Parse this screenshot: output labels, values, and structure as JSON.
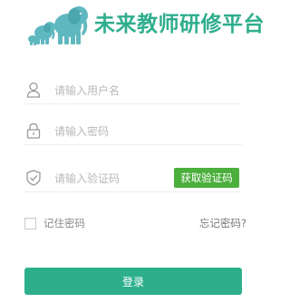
{
  "header": {
    "logo_icon": "elephant-family-icon",
    "title": "未来教师研修平台"
  },
  "form": {
    "username": {
      "icon": "user-icon",
      "placeholder": "请输入用户名",
      "value": ""
    },
    "password": {
      "icon": "lock-icon",
      "placeholder": "请输入密码",
      "value": ""
    },
    "captcha": {
      "icon": "shield-check-icon",
      "placeholder": "请输入验证码",
      "value": "",
      "get_code_label": "获取验证码"
    },
    "remember_label": "记住密码",
    "remember_checked": false,
    "forgot_label": "忘记密码?",
    "login_label": "登录"
  },
  "colors": {
    "brand": "#2fae8d",
    "login_button": "#2eaf8b",
    "code_button": "#4cae3d",
    "elephant": "#5fb8c0"
  }
}
